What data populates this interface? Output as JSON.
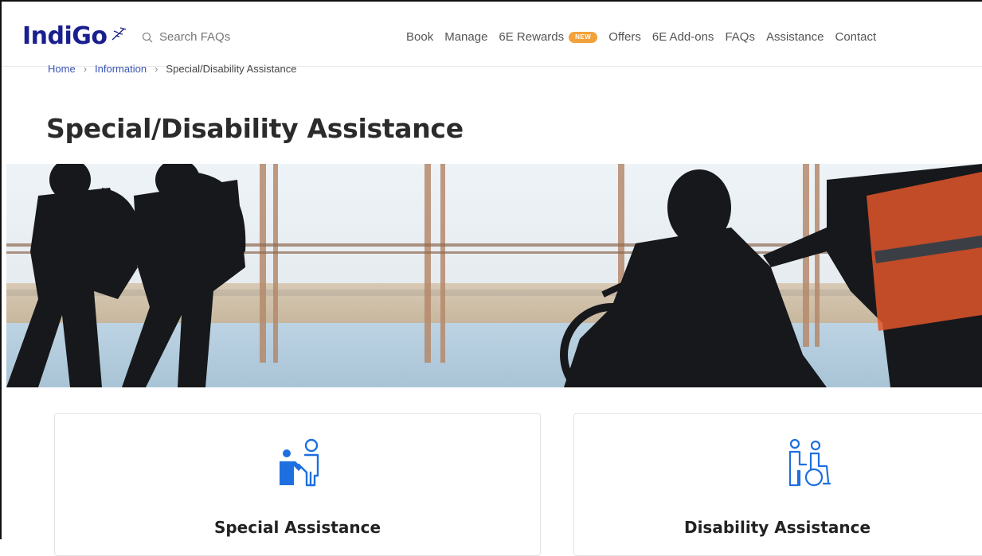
{
  "header": {
    "logo_text": "IndiGo",
    "search": {
      "placeholder": "Search FAQs"
    },
    "nav": [
      {
        "label": "Book"
      },
      {
        "label": "Manage"
      },
      {
        "label": "6E Rewards",
        "badge": "NEW"
      },
      {
        "label": "Offers"
      },
      {
        "label": "6E Add-ons"
      },
      {
        "label": "FAQs"
      },
      {
        "label": "Assistance"
      },
      {
        "label": "Contact"
      }
    ]
  },
  "breadcrumb": {
    "items": [
      "Home",
      "Information"
    ],
    "current": "Special/Disability Assistance"
  },
  "page": {
    "title": "Special/Disability Assistance"
  },
  "cards": [
    {
      "title": "Special Assistance",
      "icon": "special-assistance-icon"
    },
    {
      "title": "Disability Assistance",
      "icon": "wheelchair-assistance-icon"
    }
  ],
  "colors": {
    "brand": "#1a1f8f",
    "accent_blue": "#1e6fe0",
    "badge": "#f2a23a",
    "link": "#3a55b4"
  }
}
